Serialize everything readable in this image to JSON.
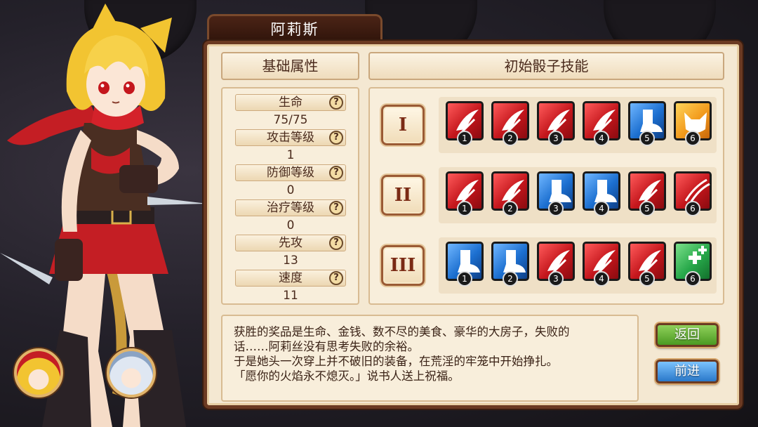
{
  "character": {
    "name": "阿莉斯"
  },
  "headers": {
    "base_stats": "基础属性",
    "dice_skills": "初始骰子技能"
  },
  "stats": [
    {
      "label": "生命",
      "value": "75/75"
    },
    {
      "label": "攻击等级",
      "value": "1"
    },
    {
      "label": "防御等级",
      "value": "0"
    },
    {
      "label": "治疗等级",
      "value": "0"
    },
    {
      "label": "先攻",
      "value": "13"
    },
    {
      "label": "速度",
      "value": "11"
    }
  ],
  "help_glyph": "?",
  "skill_rows": [
    {
      "numeral": "I",
      "dice": [
        {
          "num": "1",
          "color": "red",
          "icon": "slash-attack-icon"
        },
        {
          "num": "2",
          "color": "red",
          "icon": "slash-attack-icon"
        },
        {
          "num": "3",
          "color": "red",
          "icon": "slash-attack-icon"
        },
        {
          "num": "4",
          "color": "red",
          "icon": "slash-attack-icon"
        },
        {
          "num": "5",
          "color": "blue",
          "icon": "boot-move-icon"
        },
        {
          "num": "6",
          "color": "orange",
          "icon": "fox-face-icon"
        }
      ]
    },
    {
      "numeral": "II",
      "dice": [
        {
          "num": "1",
          "color": "red",
          "icon": "slash-attack-icon"
        },
        {
          "num": "2",
          "color": "red",
          "icon": "slash-attack-icon"
        },
        {
          "num": "3",
          "color": "blue",
          "icon": "boot-move-icon"
        },
        {
          "num": "4",
          "color": "blue",
          "icon": "boot-move-icon"
        },
        {
          "num": "5",
          "color": "red",
          "icon": "slash-attack-icon"
        },
        {
          "num": "6",
          "color": "red",
          "icon": "claw-slash-icon"
        }
      ]
    },
    {
      "numeral": "III",
      "dice": [
        {
          "num": "1",
          "color": "blue",
          "icon": "boot-move-icon"
        },
        {
          "num": "2",
          "color": "blue",
          "icon": "boot-move-icon"
        },
        {
          "num": "3",
          "color": "red",
          "icon": "slash-attack-icon"
        },
        {
          "num": "4",
          "color": "red",
          "icon": "slash-attack-icon"
        },
        {
          "num": "5",
          "color": "red",
          "icon": "slash-attack-icon"
        },
        {
          "num": "6",
          "color": "green",
          "icon": "heal-plus-icon"
        }
      ]
    }
  ],
  "story": [
    "获胜的奖品是生命、金钱、数不尽的美食、豪华的大房子，失败的",
    "话……阿莉丝没有思考失败的余裕。",
    "于是她头一次穿上并不破旧的装备，在荒淫的牢笼中开始挣扎。",
    "「愿你的火焰永不熄灭。」说书人送上祝福。"
  ],
  "buttons": {
    "back": "返回",
    "next": "前进"
  },
  "colors": {
    "attack": "#c4161c",
    "move": "#1c6fd0",
    "special": "#f29a1c",
    "heal": "#27a84a",
    "panel": "#f4e8d2",
    "frame": "#6b3a22"
  }
}
